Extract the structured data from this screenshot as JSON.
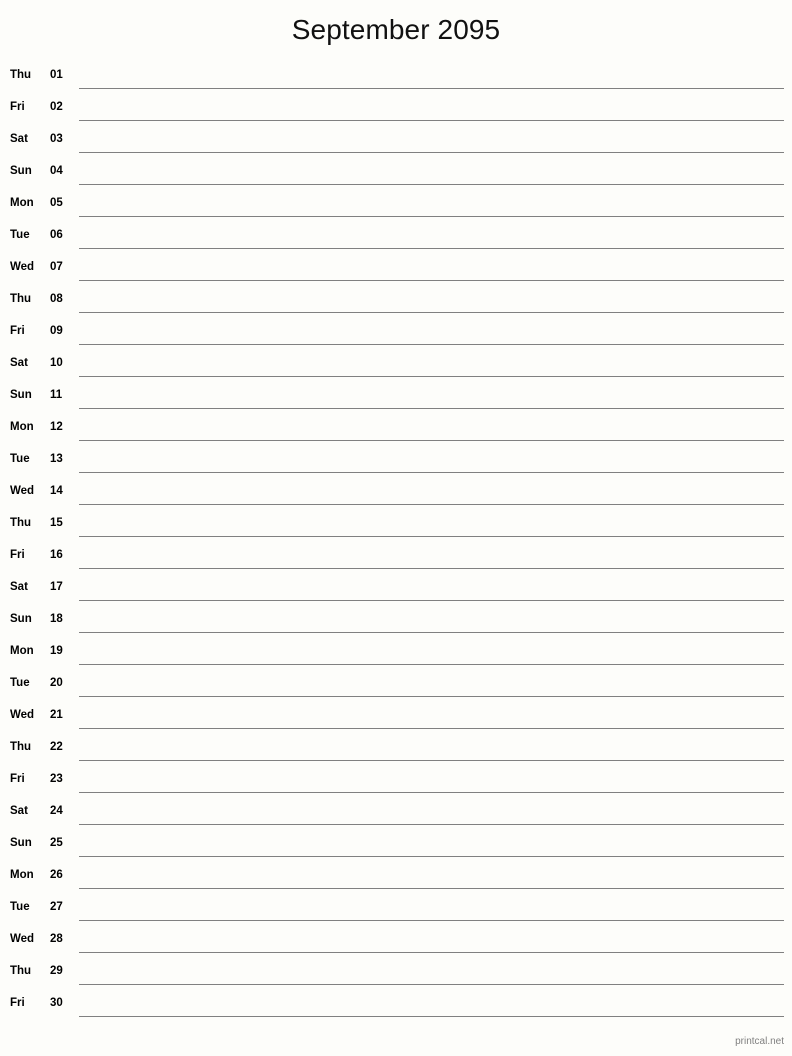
{
  "document": {
    "title": "September 2095",
    "month": "September",
    "year": "2095",
    "layout": "single-column-notes",
    "background_color": "#fdfdfa",
    "line_color": "#808080",
    "text_color": "#000000"
  },
  "footer": {
    "label": "printcal.net",
    "color": "#808080"
  },
  "days": [
    {
      "weekday": "Thu",
      "number": "01"
    },
    {
      "weekday": "Fri",
      "number": "02"
    },
    {
      "weekday": "Sat",
      "number": "03"
    },
    {
      "weekday": "Sun",
      "number": "04"
    },
    {
      "weekday": "Mon",
      "number": "05"
    },
    {
      "weekday": "Tue",
      "number": "06"
    },
    {
      "weekday": "Wed",
      "number": "07"
    },
    {
      "weekday": "Thu",
      "number": "08"
    },
    {
      "weekday": "Fri",
      "number": "09"
    },
    {
      "weekday": "Sat",
      "number": "10"
    },
    {
      "weekday": "Sun",
      "number": "11"
    },
    {
      "weekday": "Mon",
      "number": "12"
    },
    {
      "weekday": "Tue",
      "number": "13"
    },
    {
      "weekday": "Wed",
      "number": "14"
    },
    {
      "weekday": "Thu",
      "number": "15"
    },
    {
      "weekday": "Fri",
      "number": "16"
    },
    {
      "weekday": "Sat",
      "number": "17"
    },
    {
      "weekday": "Sun",
      "number": "18"
    },
    {
      "weekday": "Mon",
      "number": "19"
    },
    {
      "weekday": "Tue",
      "number": "20"
    },
    {
      "weekday": "Wed",
      "number": "21"
    },
    {
      "weekday": "Thu",
      "number": "22"
    },
    {
      "weekday": "Fri",
      "number": "23"
    },
    {
      "weekday": "Sat",
      "number": "24"
    },
    {
      "weekday": "Sun",
      "number": "25"
    },
    {
      "weekday": "Mon",
      "number": "26"
    },
    {
      "weekday": "Tue",
      "number": "27"
    },
    {
      "weekday": "Wed",
      "number": "28"
    },
    {
      "weekday": "Thu",
      "number": "29"
    },
    {
      "weekday": "Fri",
      "number": "30"
    }
  ]
}
